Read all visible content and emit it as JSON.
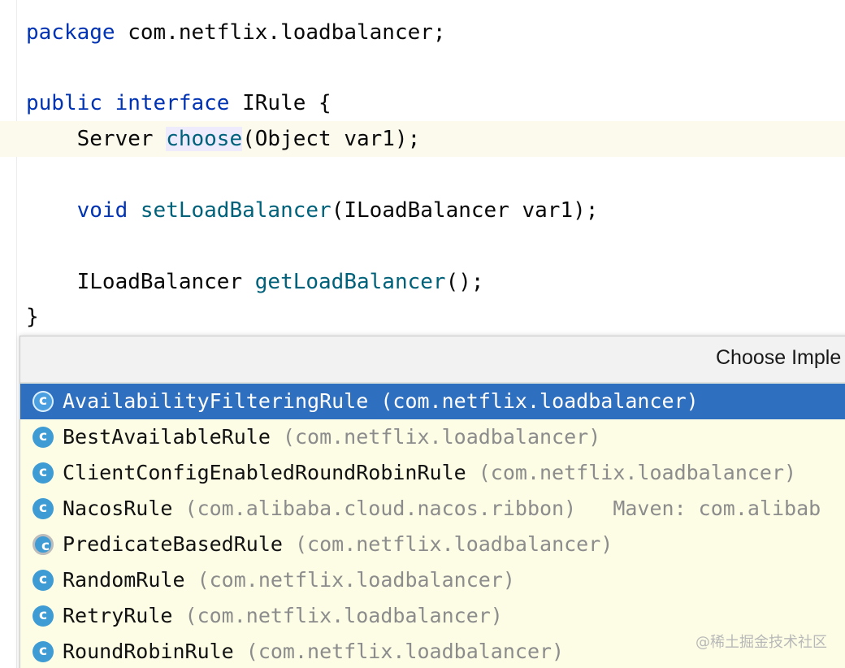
{
  "editor": {
    "lines": {
      "package_kw": "package",
      "package_name": " com.netflix.loadbalancer;",
      "public_kw": "public",
      "interface_kw": "interface",
      "interface_name": " IRule {",
      "choose_type": "    Server ",
      "choose_fn": "choose",
      "choose_args": "(Object var1);",
      "void_kw": "    void",
      "setlb_fn": "setLoadBalancer",
      "setlb_args": "(ILoadBalancer var1);",
      "getlb_type": "    ILoadBalancer ",
      "getlb_fn": "getLoadBalancer",
      "getlb_args": "();",
      "closing_brace": "}"
    }
  },
  "popup": {
    "title": "Choose Imple",
    "items": [
      {
        "name": "AvailabilityFilteringRule",
        "package": " (com.netflix.loadbalancer)",
        "extra": "",
        "selected": true,
        "icon": "class-icon"
      },
      {
        "name": "BestAvailableRule",
        "package": " (com.netflix.loadbalancer)",
        "extra": "",
        "selected": false,
        "icon": "class-icon"
      },
      {
        "name": "ClientConfigEnabledRoundRobinRule",
        "package": " (com.netflix.loadbalancer)",
        "extra": "",
        "selected": false,
        "icon": "class-icon"
      },
      {
        "name": "NacosRule",
        "package": " (com.alibaba.cloud.nacos.ribbon)",
        "extra": "   Maven: com.alibab",
        "selected": false,
        "icon": "class-icon"
      },
      {
        "name": "PredicateBasedRule",
        "package": " (com.netflix.loadbalancer)",
        "extra": "",
        "selected": false,
        "icon": "abstract-class-icon"
      },
      {
        "name": "RandomRule",
        "package": " (com.netflix.loadbalancer)",
        "extra": "",
        "selected": false,
        "icon": "class-icon"
      },
      {
        "name": "RetryRule",
        "package": " (com.netflix.loadbalancer)",
        "extra": "",
        "selected": false,
        "icon": "class-icon"
      },
      {
        "name": "RoundRobinRule",
        "package": " (com.netflix.loadbalancer)",
        "extra": "",
        "selected": false,
        "icon": "class-icon"
      }
    ]
  },
  "watermark": "@稀土掘金技术社区",
  "colors": {
    "keyword": "#0033b3",
    "method": "#00627a",
    "selection": "#2f6fbf",
    "popup_bg": "#fdfde6",
    "caret_row": "#fcfaed"
  }
}
